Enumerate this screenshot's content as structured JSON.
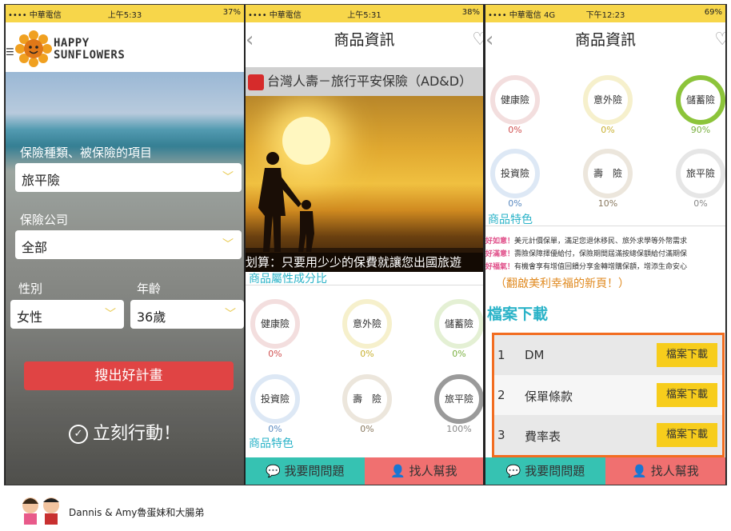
{
  "phone1": {
    "status": {
      "carrier": "•••• 中華電信",
      "time": "上午5:33",
      "battery": "37%"
    },
    "brand": [
      "HAPPY",
      "SUNFLOWERS"
    ],
    "label_type": "保險種類、被保險的項目",
    "select_type": "旅平險",
    "label_company": "保險公司",
    "select_company": "全部",
    "label_gender": "性別",
    "label_age": "年齡",
    "select_gender": "女性",
    "select_age": "36歲",
    "search_button": "搜出好計畫",
    "action": "立刻行動！"
  },
  "phone2": {
    "status": {
      "carrier": "•••• 中華電信",
      "time": "上午5:31",
      "battery": "38%"
    },
    "nav_title": "商品資訊",
    "product_title": "台灣人壽－旅行平安保險（AD&D）",
    "caption": "划算：只要用少少的保費就讓您出國旅遊",
    "section_attr": "商品屬性成分比",
    "rings": [
      {
        "label": "健康險",
        "pct": "0%",
        "color": "#f3dede",
        "pctColor": "#d05050"
      },
      {
        "label": "意外險",
        "pct": "0%",
        "color": "#f6f0cc",
        "pctColor": "#c8b030"
      },
      {
        "label": "儲蓄險",
        "pct": "0%",
        "color": "#e4f0d4",
        "pctColor": "#7ab040"
      },
      {
        "label": "投資險",
        "pct": "0%",
        "color": "#dde8f5",
        "pctColor": "#5a8ac0"
      },
      {
        "label": "壽　險",
        "pct": "0%",
        "color": "#ece6dc",
        "pctColor": "#8a7a60"
      },
      {
        "label": "旅平險",
        "pct": "100%",
        "color": "#9a9a9a",
        "pctColor": "#888888"
      }
    ],
    "section_feature": "商品特色",
    "ask": "我要問問題",
    "help": "找人幫我"
  },
  "phone3": {
    "status": {
      "carrier": "•••• 中華電信 4G",
      "time": "下午12:23",
      "battery": "69%"
    },
    "nav_title": "商品資訊",
    "rings": [
      {
        "label": "健康險",
        "pct": "0%",
        "color": "#f3dede",
        "pctColor": "#d05050"
      },
      {
        "label": "意外險",
        "pct": "0%",
        "color": "#f6f0cc",
        "pctColor": "#c8b030"
      },
      {
        "label": "儲蓄險",
        "pct": "90%",
        "color": "#8cc43a",
        "pctColor": "#7ab040"
      },
      {
        "label": "投資險",
        "pct": "0%",
        "color": "#dde8f5",
        "pctColor": "#5a8ac0"
      },
      {
        "label": "壽　險",
        "pct": "10%",
        "color": "#ece6dc",
        "pctColor": "#8a7a60"
      },
      {
        "label": "旅平險",
        "pct": "0%",
        "color": "#e6e6e6",
        "pctColor": "#888888"
      }
    ],
    "section_feature": "商品特色",
    "features": [
      {
        "tag": "好如意！",
        "text": "美元計價保單，滿足您退休移民、旅外求學等外幣需求"
      },
      {
        "tag": "好滿意！",
        "text": "壽險保障擇優給付，保險期間屆滿按總保額給付滿期保"
      },
      {
        "tag": "好福氣！",
        "text": "有機會享有增值回饋分享金轉增購保額，增添生命安心"
      }
    ],
    "promo": "（翻啟美利幸福的新頁！）",
    "download_title": "檔案下載",
    "downloads": [
      {
        "num": "1",
        "name": "DM",
        "btn": "檔案下載"
      },
      {
        "num": "2",
        "name": "保單條款",
        "btn": "檔案下載"
      },
      {
        "num": "3",
        "name": "費率表",
        "btn": "檔案下載"
      }
    ],
    "ask": "我要問問題",
    "help": "找人幫我"
  },
  "footer": "Dannis & Amy魯蛋妹和大腸弟"
}
